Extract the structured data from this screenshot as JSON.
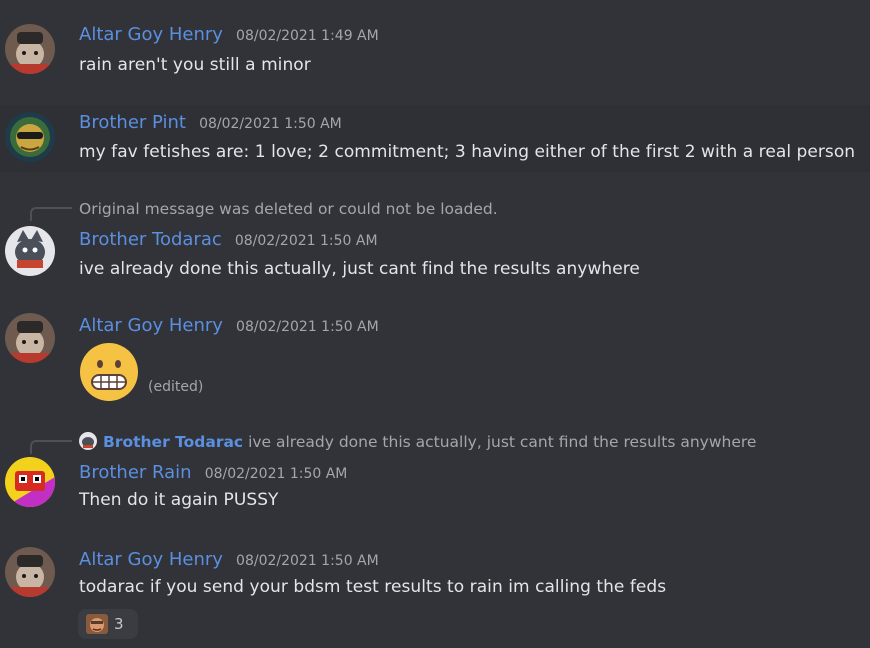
{
  "messages": [
    {
      "username": "Altar Goy Henry",
      "timestamp": "08/02/2021 1:49 AM",
      "text": "rain aren't you still a minor"
    },
    {
      "username": "Brother Pint",
      "timestamp": "08/02/2021 1:50 AM",
      "text": "my fav fetishes are: 1 love; 2 commitment; 3 having either of the first 2 with a real person"
    },
    {
      "reply_note": "Original message was deleted or could not be loaded.",
      "username": "Brother Todarac",
      "timestamp": "08/02/2021 1:50 AM",
      "text": "ive already done this actually, just cant find the results anywhere"
    },
    {
      "username": "Altar Goy Henry",
      "timestamp": "08/02/2021 1:50 AM",
      "edited": "(edited)",
      "emoji": "grimacing-face"
    },
    {
      "reply_user": "Brother Todarac",
      "reply_text": "ive already done this actually, just cant find the results anywhere",
      "username": "Brother Rain",
      "timestamp": "08/02/2021 1:50 AM",
      "text": "Then do it again PUSSY"
    },
    {
      "username": "Altar Goy Henry",
      "timestamp": "08/02/2021 1:50 AM",
      "text": "todarac if you send your bdsm test results to rain im calling the feds",
      "reaction_count": "3"
    }
  ],
  "colors": {
    "background": "#313338",
    "username": "#5b8fe0",
    "timestamp": "#a3a6aa",
    "text": "#e3e5e8"
  }
}
